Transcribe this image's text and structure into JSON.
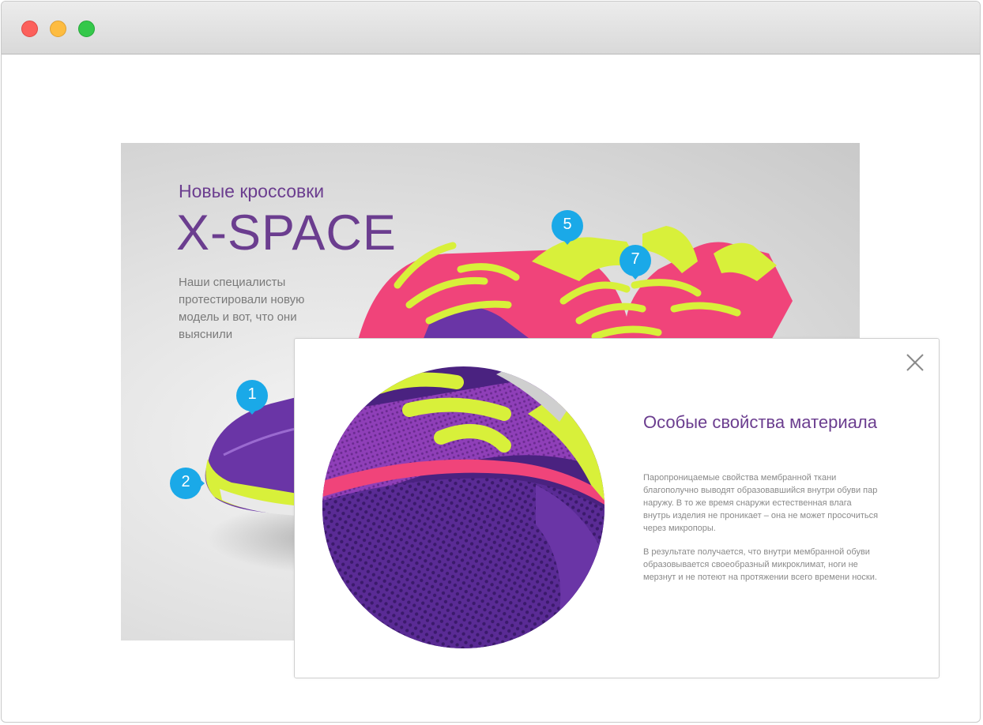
{
  "window": {
    "controls": [
      "close",
      "minimize",
      "zoom"
    ]
  },
  "hero": {
    "subtitle": "Новые кроссовки",
    "title": "X-SPACE",
    "description": "Наши специалисты протестировали новую модель и вот, что они выяснили",
    "pins": [
      "1",
      "2",
      "5",
      "7"
    ]
  },
  "modal": {
    "title": "Особые свойства материала",
    "paragraph1": "Паропроницаемые свойства мембранной ткани благополучно выводят образовавшийся внутри обуви пар наружу. В то же время снаружи естественная влага внутрь изделия не проникает – она не может просочиться через микропоры.",
    "paragraph2": "В результате получается, что внутри мембранной обуви образовывается своеобразный микроклимат, ноги не мерзнут и не потеют на протяжении всего времени носки.",
    "close_icon": "close-icon"
  },
  "colors": {
    "brand_purple": "#6b3d8f",
    "pin_blue": "#1aa9e8",
    "shoe_purple": "#6a35a6",
    "shoe_pink": "#f0447a",
    "lace_lime": "#d8f03a"
  }
}
